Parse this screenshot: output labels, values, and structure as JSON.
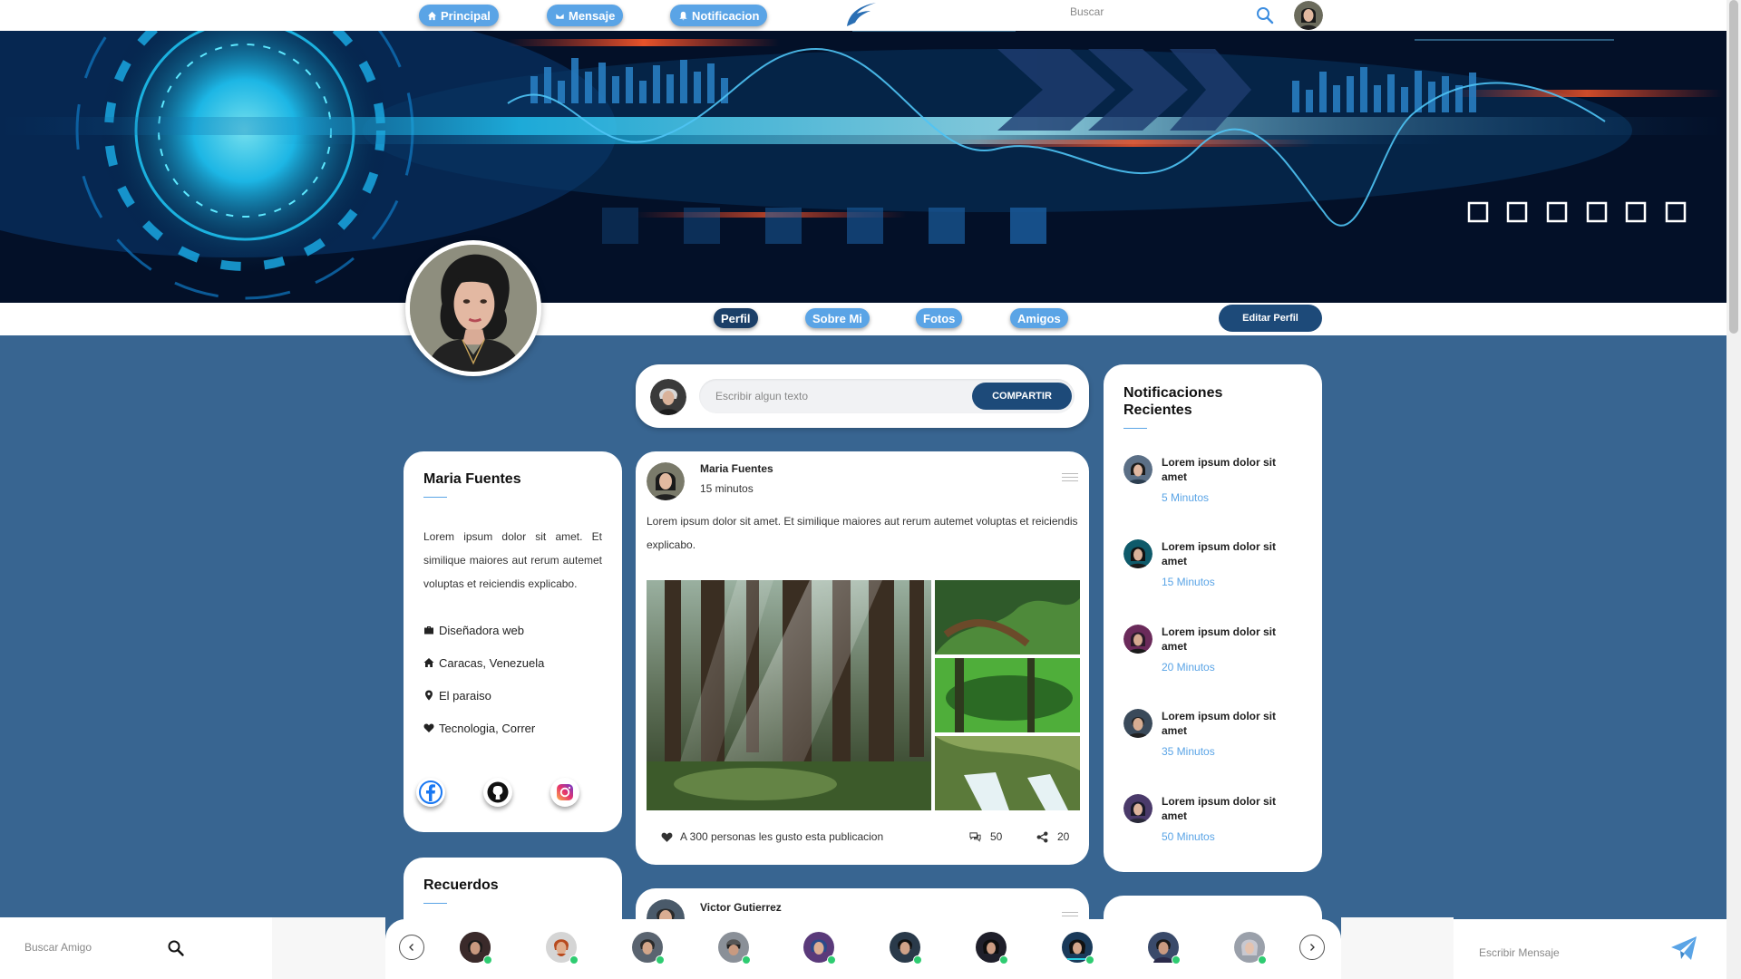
{
  "nav": {
    "home_label": "Principal",
    "messages_label": "Mensaje",
    "notifications_label": "Notificacion",
    "search_placeholder": "Buscar"
  },
  "profile_tabs": {
    "profile": "Perfil",
    "about": "Sobre Mi",
    "photos": "Fotos",
    "friends": "Amigos",
    "edit_profile": "Editar Perfil"
  },
  "about_card": {
    "name": "Maria Fuentes",
    "description": "Lorem ipsum dolor sit amet. Et similique maiores aut rerum autemet voluptas et reiciendis explicabo.",
    "job": "Diseñadora web",
    "home": "Caracas, Venezuela",
    "location": "El paraiso",
    "interests": "Tecnologia, Correr"
  },
  "memories_card": {
    "title": "Recuerdos"
  },
  "composer": {
    "placeholder": "Escribir algun texto",
    "share_label": "COMPARTIR"
  },
  "post": {
    "author": "Maria Fuentes",
    "time": "15 minutos",
    "text": "Lorem ipsum dolor sit amet. Et similique maiores aut rerum autemet voluptas et reiciendis explicabo.",
    "likes_text": "A 300 personas les gusto esta publicacion",
    "comments": "50",
    "shares": "20"
  },
  "post2": {
    "author": "Victor Gutierrez"
  },
  "notifications": {
    "title": "Notificaciones Recientes",
    "items": [
      {
        "text": "Lorem ipsum dolor sit amet",
        "time": "5 Minutos"
      },
      {
        "text": "Lorem ipsum dolor sit amet",
        "time": "15 Minutos"
      },
      {
        "text": "Lorem ipsum dolor sit amet",
        "time": "20 Minutos"
      },
      {
        "text": "Lorem ipsum dolor sit amet",
        "time": "35 Minutos"
      },
      {
        "text": "Lorem ipsum dolor sit amet",
        "time": "50 Minutos"
      }
    ]
  },
  "bottom": {
    "search_friend_placeholder": "Buscar Amigo",
    "message_placeholder": "Escribir Mensaje"
  },
  "colors": {
    "page_bg": "#386591",
    "accent": "#5aa4e6",
    "primary_button": "#1d4a79",
    "online": "#2ecc71"
  }
}
